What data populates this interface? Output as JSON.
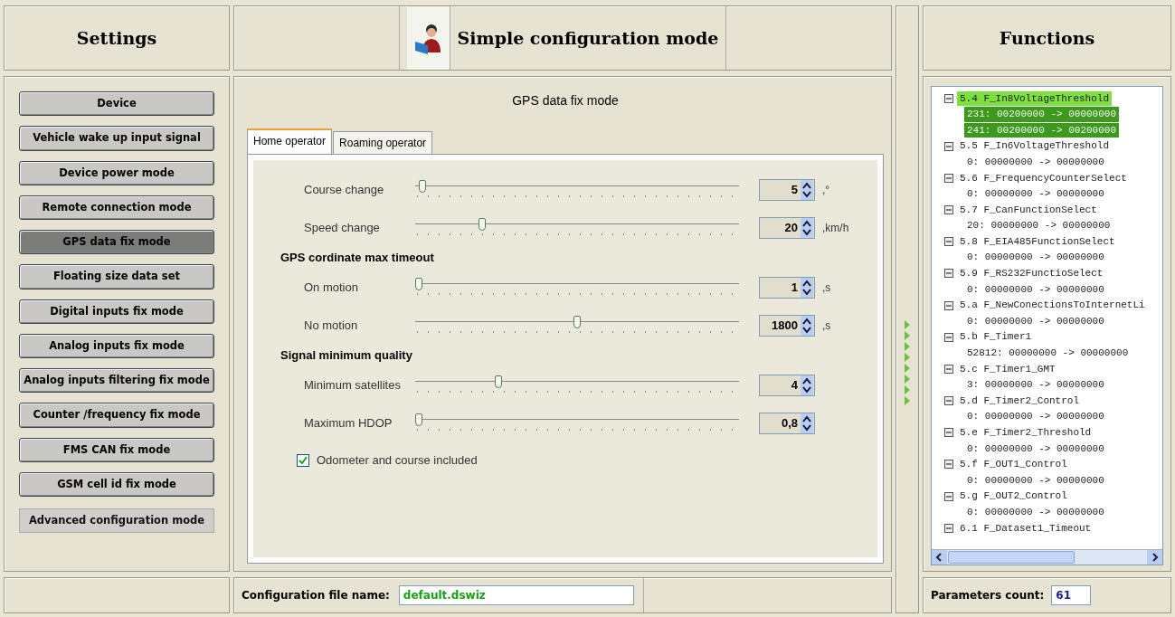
{
  "settings": {
    "title": "Settings",
    "items": [
      {
        "label": "Device",
        "selected": false
      },
      {
        "label": "Vehicle wake up input signal",
        "selected": false
      },
      {
        "label": "Device power mode",
        "selected": false
      },
      {
        "label": "Remote connection mode",
        "selected": false
      },
      {
        "label": "GPS data fix mode",
        "selected": true
      },
      {
        "label": "Floating size data set",
        "selected": false
      },
      {
        "label": "Digital inputs fix mode",
        "selected": false
      },
      {
        "label": "Analog inputs fix mode",
        "selected": false
      },
      {
        "label": "Analog inputs filtering fix mode",
        "selected": false
      },
      {
        "label": "Counter /frequency fix mode",
        "selected": false
      },
      {
        "label": "FMS CAN fix mode",
        "selected": false
      },
      {
        "label": "GSM cell id fix mode",
        "selected": false
      }
    ],
    "advanced_button": "Advanced configuration mode"
  },
  "main": {
    "title": "Simple configuration mode",
    "section_title": "GPS data fix mode",
    "tabs": [
      {
        "label": "Home operator",
        "selected": true
      },
      {
        "label": "Roaming operator",
        "selected": false
      }
    ],
    "rows": [
      {
        "kind": "slider",
        "label": "Course change",
        "level": 0.01,
        "value": "5",
        "unit": ",°"
      },
      {
        "kind": "slider",
        "label": "Speed change",
        "level": 0.2,
        "value": "20",
        "unit": ",km/h"
      },
      {
        "kind": "heading",
        "label": "GPS cordinate max timeout"
      },
      {
        "kind": "slider",
        "label": "On motion",
        "level": 0.0,
        "value": "1",
        "unit": ",s"
      },
      {
        "kind": "slider",
        "label": "No motion",
        "level": 0.5,
        "value": "1800",
        "unit": ",s"
      },
      {
        "kind": "heading",
        "label": "Signal minimum quality"
      },
      {
        "kind": "slider",
        "label": "Minimum satellites",
        "level": 0.25,
        "value": "4"
      },
      {
        "kind": "slider",
        "label": "Maximum HDOP",
        "level": 0.0,
        "value": "0,8"
      },
      {
        "kind": "checkbox",
        "label": "Odometer and course included",
        "checked": true
      }
    ],
    "file_label": "Configuration file name:",
    "file_value": "default.dswiz"
  },
  "functions": {
    "title": "Functions",
    "tree": [
      {
        "label": "5.4 F_In8VoltageThreshold",
        "expanded": true,
        "selected": true,
        "children": [
          {
            "label": "231: 00200000 -> 00000000",
            "selected": true
          },
          {
            "label": "241: 00200000 -> 00200000",
            "selected": true
          }
        ]
      },
      {
        "label": "5.5 F_In6VoltageThreshold",
        "expanded": true,
        "selected": false,
        "children": [
          {
            "label": "0: 00000000 -> 00000000",
            "selected": false
          }
        ]
      },
      {
        "label": "5.6 F_FrequencyCounterSelect",
        "expanded": true,
        "selected": false,
        "children": [
          {
            "label": "0: 00000000 -> 00000000",
            "selected": false
          }
        ]
      },
      {
        "label": "5.7 F_CanFunctionSelect",
        "expanded": true,
        "selected": false,
        "children": [
          {
            "label": "20: 00000000 -> 00000000",
            "selected": false
          }
        ]
      },
      {
        "label": "5.8 F_EIA485FunctionSelect",
        "expanded": true,
        "selected": false,
        "children": [
          {
            "label": "0: 00000000 -> 00000000",
            "selected": false
          }
        ]
      },
      {
        "label": "5.9 F_RS232FunctioSelect",
        "expanded": true,
        "selected": false,
        "children": [
          {
            "label": "0: 00000000 -> 00000000",
            "selected": false
          }
        ]
      },
      {
        "label": "5.a F_NewConectionsToInternetLi",
        "expanded": true,
        "selected": false,
        "children": [
          {
            "label": "0: 00000000 -> 00000000",
            "selected": false
          }
        ]
      },
      {
        "label": "5.b F_Timer1",
        "expanded": true,
        "selected": false,
        "children": [
          {
            "label": "52812: 00000000 -> 00000000",
            "selected": false
          }
        ]
      },
      {
        "label": "5.c F_Timer1_GMT",
        "expanded": true,
        "selected": false,
        "children": [
          {
            "label": "3: 00000000 -> 00000000",
            "selected": false
          }
        ]
      },
      {
        "label": "5.d F_Timer2_Control",
        "expanded": true,
        "selected": false,
        "children": [
          {
            "label": "0: 00000000 -> 00000000",
            "selected": false
          }
        ]
      },
      {
        "label": "5.e F_Timer2_Threshold",
        "expanded": true,
        "selected": false,
        "children": [
          {
            "label": "0: 00000000 -> 00000000",
            "selected": false
          }
        ]
      },
      {
        "label": "5.f F_OUT1_Control",
        "expanded": true,
        "selected": false,
        "children": [
          {
            "label": "0: 00000000 -> 00000000",
            "selected": false
          }
        ]
      },
      {
        "label": "5.g F_OUT2_Control",
        "expanded": true,
        "selected": false,
        "children": [
          {
            "label": "0: 00000000 -> 00000000",
            "selected": false
          }
        ]
      },
      {
        "label": "6.1 F_Dataset1_Timeout",
        "expanded": true,
        "selected": false
      }
    ],
    "count_label": "Parameters count:",
    "count_value": "61"
  }
}
